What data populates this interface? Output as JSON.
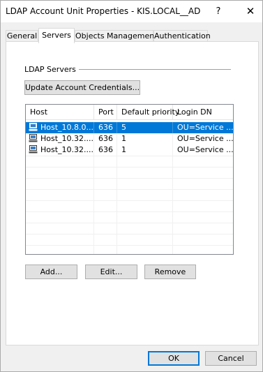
{
  "window": {
    "title": "LDAP Account Unit Properties - KIS.LOCAL__AD",
    "help_label": "?",
    "close_label": "✕"
  },
  "tabs": [
    {
      "label": "General",
      "active": false
    },
    {
      "label": "Servers",
      "active": true
    },
    {
      "label": "Objects Management",
      "active": false
    },
    {
      "label": "Authentication",
      "active": false
    }
  ],
  "servers_group": {
    "label": "LDAP Servers",
    "update_button": "Update Account Credentials...",
    "columns": [
      "Host",
      "Port",
      "Default priority",
      "Login DN"
    ],
    "rows": [
      {
        "host": "Host_10.8.0....",
        "port": "636",
        "priority": "5",
        "login_dn": "OU=Service ...",
        "selected": true,
        "icon": "computer-icon"
      },
      {
        "host": "Host_10.32....",
        "port": "636",
        "priority": "1",
        "login_dn": "OU=Service ...",
        "selected": false,
        "icon": "computer-icon"
      },
      {
        "host": "Host_10.32....",
        "port": "636",
        "priority": "1",
        "login_dn": "OU=Service ...",
        "selected": false,
        "icon": "computer-icon"
      }
    ],
    "add_button": "Add...",
    "edit_button": "Edit...",
    "remove_button": "Remove"
  },
  "footer": {
    "ok_label": "OK",
    "cancel_label": "Cancel"
  },
  "colors": {
    "selection": "#0078d7",
    "dialog_background": "#f0f0f0",
    "button_face": "#e1e1e1"
  }
}
